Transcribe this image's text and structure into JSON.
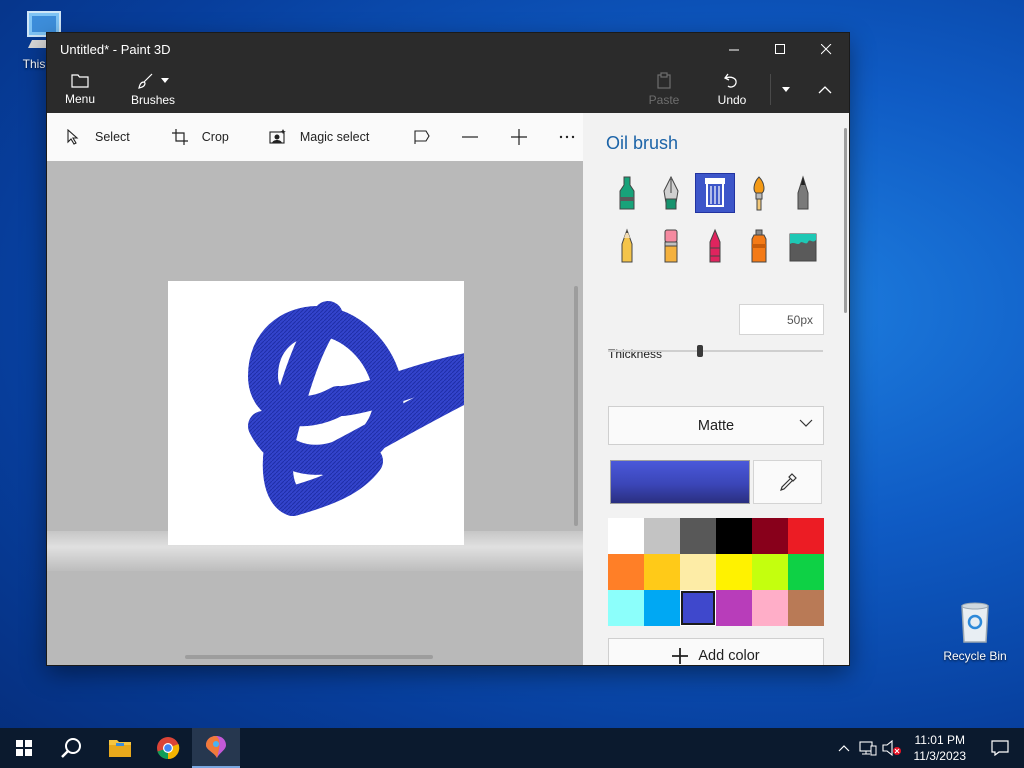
{
  "desktop": {
    "icons": [
      {
        "label": "This PC"
      },
      {
        "label": "Recycle Bin"
      }
    ]
  },
  "window": {
    "title": "Untitled* - Paint 3D",
    "controls": {
      "minimize": "minimize-icon",
      "maximize": "maximize-icon",
      "close": "close-icon"
    },
    "ribbon": {
      "menu_label": "Menu",
      "brushes_label": "Brushes",
      "paste_label": "Paste",
      "undo_label": "Undo"
    },
    "toolbar": {
      "select_label": "Select",
      "crop_label": "Crop",
      "magic_select_label": "Magic select"
    }
  },
  "panel": {
    "title": "Oil brush",
    "brushes": [
      {
        "name": "marker",
        "selected": false
      },
      {
        "name": "calligraphy-pen",
        "selected": false
      },
      {
        "name": "oil-brush",
        "selected": true
      },
      {
        "name": "watercolor",
        "selected": false
      },
      {
        "name": "pixel-pen",
        "selected": false
      },
      {
        "name": "pencil",
        "selected": false
      },
      {
        "name": "eraser",
        "selected": false
      },
      {
        "name": "crayon",
        "selected": false
      },
      {
        "name": "spray-can",
        "selected": false
      },
      {
        "name": "fill",
        "selected": false
      }
    ],
    "thickness_label": "Thickness",
    "thickness_value": "50px",
    "thickness_fraction": 0.43,
    "finish_value": "Matte",
    "add_color_label": "Add color",
    "palette": [
      "#ffffff",
      "#c3c3c3",
      "#585858",
      "#000000",
      "#88001b",
      "#ec1c24",
      "#ff7f27",
      "#ffca18",
      "#fdeca6",
      "#fff200",
      "#c4ff0e",
      "#0ed145",
      "#8cfffb",
      "#00a8f3",
      "#3f48cc",
      "#b83dba",
      "#ffaec8",
      "#b97a56"
    ],
    "selected_color_index": 14
  },
  "taskbar": {
    "time": "11:01 PM",
    "date": "11/3/2023"
  }
}
